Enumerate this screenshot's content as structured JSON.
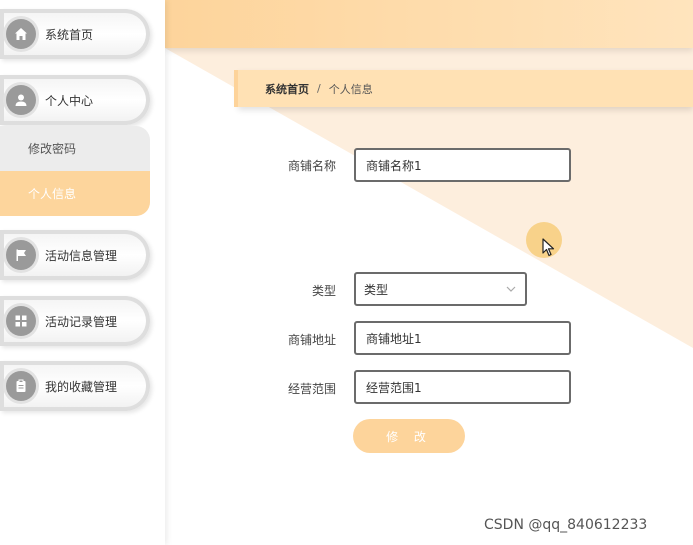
{
  "sidebar": {
    "items": [
      {
        "label": "系统首页",
        "icon": "home-icon"
      },
      {
        "label": "个人中心",
        "icon": "user-icon"
      },
      {
        "label": "活动信息管理",
        "icon": "flag-icon"
      },
      {
        "label": "活动记录管理",
        "icon": "grid-icon"
      },
      {
        "label": "我的收藏管理",
        "icon": "clipboard-icon"
      }
    ],
    "submenu": [
      {
        "label": "修改密码",
        "active": false
      },
      {
        "label": "个人信息",
        "active": true
      }
    ]
  },
  "breadcrumb": {
    "home": "系统首页",
    "separator": "/",
    "current": "个人信息"
  },
  "form": {
    "shop_name": {
      "label": "商铺名称",
      "value": "商铺名称1"
    },
    "type": {
      "label": "类型",
      "value": "类型"
    },
    "address": {
      "label": "商铺地址",
      "value": "商铺地址1"
    },
    "scope": {
      "label": "经营范围",
      "value": "经营范围1"
    },
    "submit_label": "修 改"
  },
  "watermark": "CSDN @qq_840612233",
  "colors": {
    "accent": "#fdd49b",
    "accent_light": "#ffe1b4",
    "icon_gray": "#9a9a9a"
  }
}
